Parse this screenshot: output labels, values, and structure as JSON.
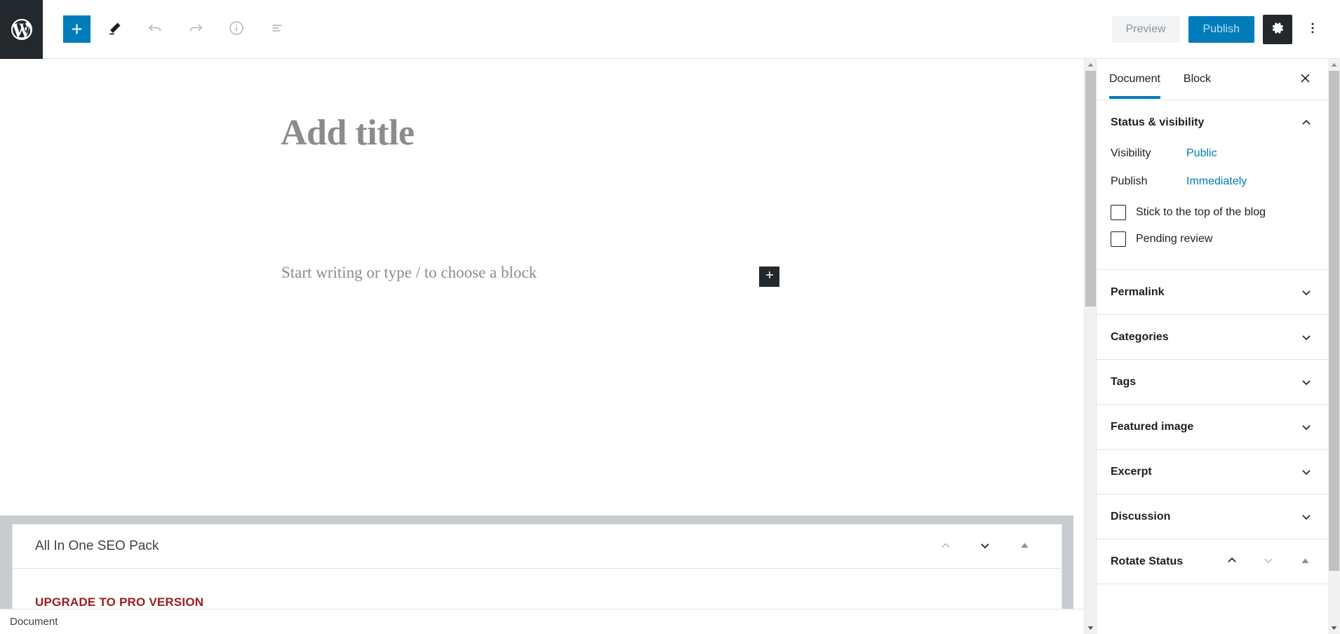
{
  "topbar": {
    "logo_icon": "wordpress-logo-icon",
    "add_block_label": "+",
    "add_block_icon": "plus-icon",
    "edit_icon": "pencil-icon",
    "undo_icon": "undo-arrow-icon",
    "redo_icon": "redo-arrow-icon",
    "info_icon": "info-circle-icon",
    "block_nav_icon": "block-navigation-icon",
    "preview_label": "Preview",
    "publish_label": "Publish",
    "settings_icon": "gear-icon",
    "more_icon": "kebab-menu-icon"
  },
  "editor": {
    "title_placeholder": "Add title",
    "block_placeholder": "Start writing or type / to choose a block",
    "inserter_icon": "plus-icon"
  },
  "metabox": {
    "seo_title": "All In One SEO Pack",
    "upgrade_label": "UPGRADE TO PRO VERSION",
    "upgrade_color": "#9b1c1c",
    "collapse_up_icon": "chevron-up-icon",
    "collapse_down_icon": "chevron-down-icon",
    "toggle_icon": "triangle-up-icon"
  },
  "sidebar": {
    "tabs": [
      {
        "label": "Document",
        "active": true
      },
      {
        "label": "Block",
        "active": false
      }
    ],
    "close_icon": "close-icon",
    "status_panel": {
      "title": "Status & visibility",
      "chevron_icon": "chevron-up-icon",
      "visibility_label": "Visibility",
      "visibility_value": "Public",
      "publish_label": "Publish",
      "publish_value": "Immediately",
      "sticky_label": "Stick to the top of the blog",
      "pending_label": "Pending review"
    },
    "panels": [
      {
        "title": "Permalink",
        "icon": "chevron-down-icon"
      },
      {
        "title": "Categories",
        "icon": "chevron-down-icon"
      },
      {
        "title": "Tags",
        "icon": "chevron-down-icon"
      },
      {
        "title": "Featured image",
        "icon": "chevron-down-icon"
      },
      {
        "title": "Excerpt",
        "icon": "chevron-down-icon"
      },
      {
        "title": "Discussion",
        "icon": "chevron-down-icon"
      }
    ],
    "rotate_panel": {
      "title": "Rotate Status",
      "up_icon": "chevron-up-icon",
      "down_icon": "chevron-down-icon",
      "toggle_icon": "triangle-up-icon"
    }
  },
  "statusbar": {
    "text": "Document"
  },
  "colors": {
    "accent": "#007cba",
    "admin_dark": "#23282d",
    "metabox_band": "#c8ccd1",
    "border": "#e2e4e7"
  }
}
